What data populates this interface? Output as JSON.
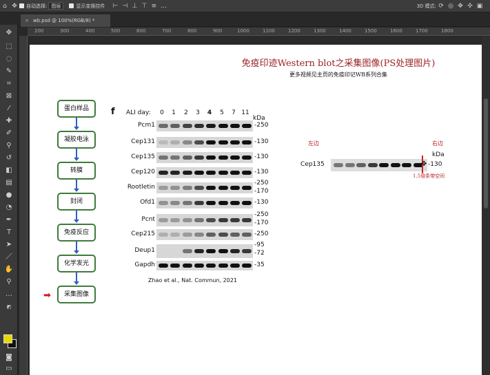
{
  "options_bar": {
    "auto_select_label": "自动选择:",
    "auto_select_target": "图层",
    "show_transform_label": "显示变换控件",
    "mode_3d_label": "3D 模式:"
  },
  "tab": {
    "close": "×",
    "title": "wb.psd @ 100%(RGB/8) *"
  },
  "ruler_marks": [
    "200",
    "300",
    "400",
    "500",
    "600",
    "700",
    "800",
    "900",
    "1000",
    "1100",
    "1200",
    "1300",
    "1400",
    "1500",
    "1600",
    "1700",
    "1800"
  ],
  "toolbar_icons": [
    "move-icon",
    "marquee-icon",
    "lasso-icon",
    "quick-select-icon",
    "crop-icon",
    "frame-icon",
    "eyedropper-icon",
    "healing-icon",
    "brush-icon",
    "stamp-icon",
    "history-brush-icon",
    "eraser-icon",
    "gradient-icon",
    "blur-icon",
    "dodge-icon",
    "pen-icon",
    "type-icon",
    "path-select-icon",
    "shape-icon",
    "hand-icon",
    "zoom-icon",
    "more-icon"
  ],
  "document": {
    "title": "免疫印迹Western blot之采集图像(PS处理图片)",
    "subtitle": "更多视频见主页的免疫印记WB系列合集",
    "flow_steps": [
      "蛋白样品",
      "凝胶电泳",
      "转膜",
      "封闭",
      "免疫反应",
      "化学发光",
      "采集图像"
    ],
    "current_step_marker": "➡",
    "panel": {
      "letter": "f",
      "day_label": "ALI day:",
      "days": [
        "0",
        "1",
        "2",
        "3",
        "4",
        "5",
        "7",
        "11"
      ],
      "kda_label": "kDa",
      "rows": [
        {
          "protein": "Pcm1",
          "mw": [
            "-250"
          ]
        },
        {
          "protein": "Cep131",
          "mw": [
            "-130"
          ]
        },
        {
          "protein": "Cep135",
          "mw": [
            "-130"
          ]
        },
        {
          "protein": "Cep120",
          "mw": [
            "-130"
          ]
        },
        {
          "protein": "Rootletin",
          "mw": [
            "-250",
            "-170"
          ]
        },
        {
          "protein": "Ofd1",
          "mw": [
            "-130"
          ]
        },
        {
          "protein": "Pcnt",
          "mw": [
            "-250",
            "-170"
          ]
        },
        {
          "protein": "Cep215",
          "mw": [
            "-250"
          ]
        },
        {
          "protein": "Deup1",
          "mw": [
            "-95",
            "-72"
          ]
        },
        {
          "protein": "Gapdh",
          "mw": [
            "-35"
          ]
        }
      ],
      "citation": "Zhao et al., Nat. Commun, 2021"
    },
    "crop_example": {
      "left_label": "左边",
      "right_label": "右边",
      "kda_label": "kDa",
      "protein": "Cep135",
      "mw": "-130",
      "spacing_note": "1.5倍条带空间"
    }
  }
}
